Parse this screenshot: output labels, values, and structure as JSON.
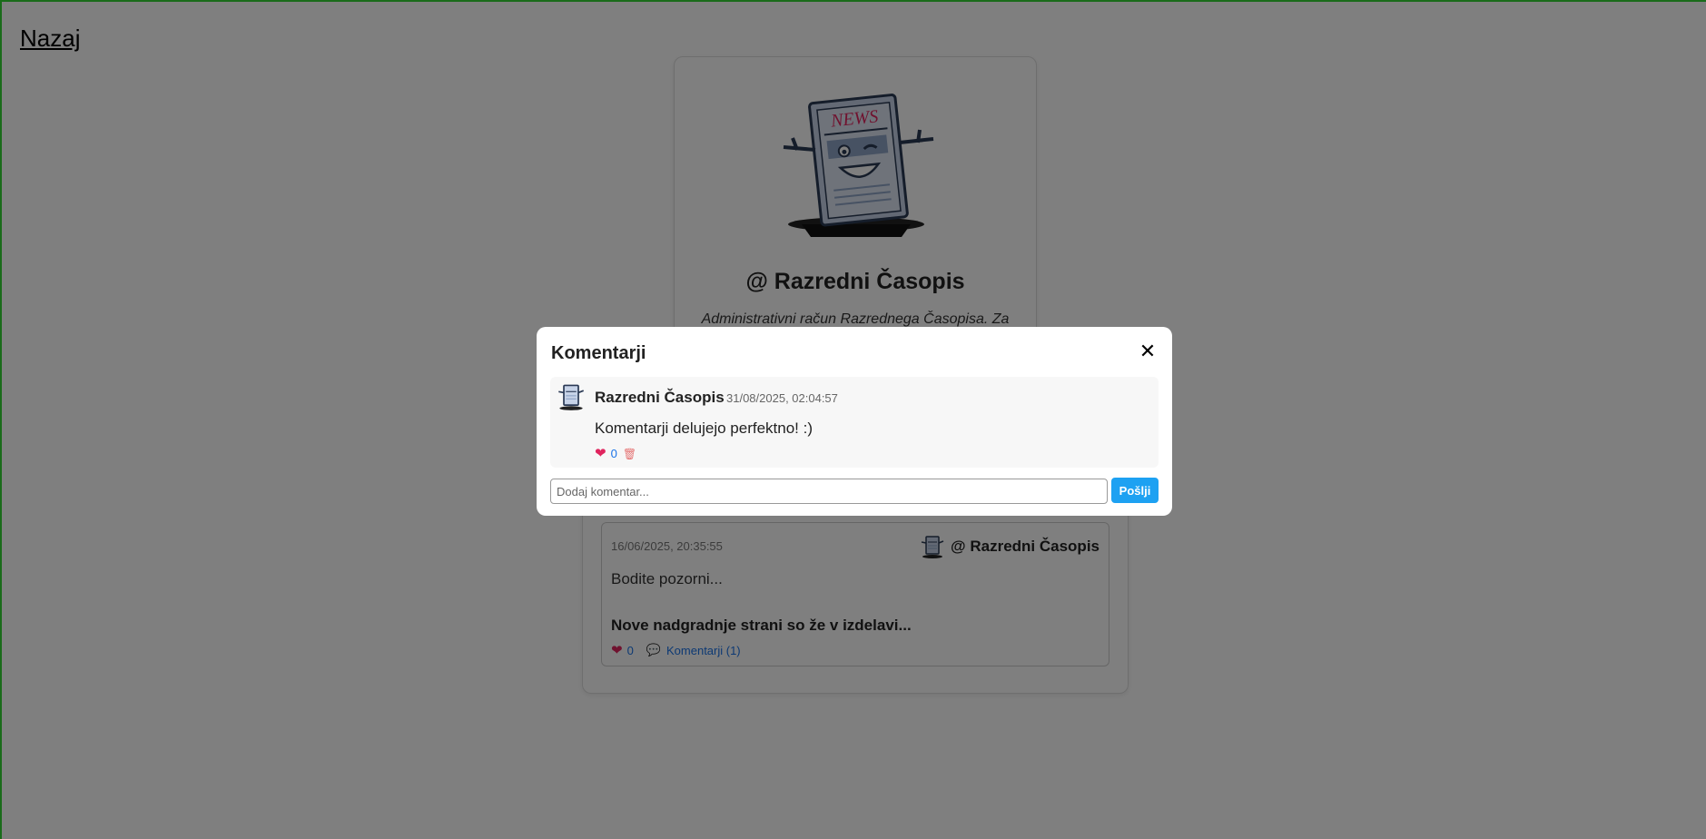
{
  "nav": {
    "back_label": "Nazaj"
  },
  "profile": {
    "name": "@ Razredni Časopis",
    "bio": "Administrativni račun Razrednega Časopisa. Za",
    "avatar_icon": "newspaper-mascot-icon"
  },
  "posts": [
    {
      "date": "16/06/2025, 20:35:55",
      "author": "@ Razredni Časopis",
      "text": "Bodite pozorni...",
      "title": "Nove nadgradnje strani so že v izdelavi...",
      "likes": "0",
      "comments_label": "Komentarji (1)"
    }
  ],
  "modal": {
    "title": "Komentarji",
    "close_label": "✕",
    "comments": [
      {
        "author": "Razredni Časopis",
        "date": "31/08/2025, 02:04:57",
        "text": "Komentarji delujejo perfektno! :)",
        "likes": "0"
      }
    ],
    "input_placeholder": "Dodaj komentar...",
    "input_value": "",
    "send_label": "Pošlji"
  },
  "colors": {
    "accent": "#1da1f2",
    "like": "#e0245e",
    "link": "#1a73e8",
    "overlay": "rgba(0,0,0,0.5)"
  }
}
